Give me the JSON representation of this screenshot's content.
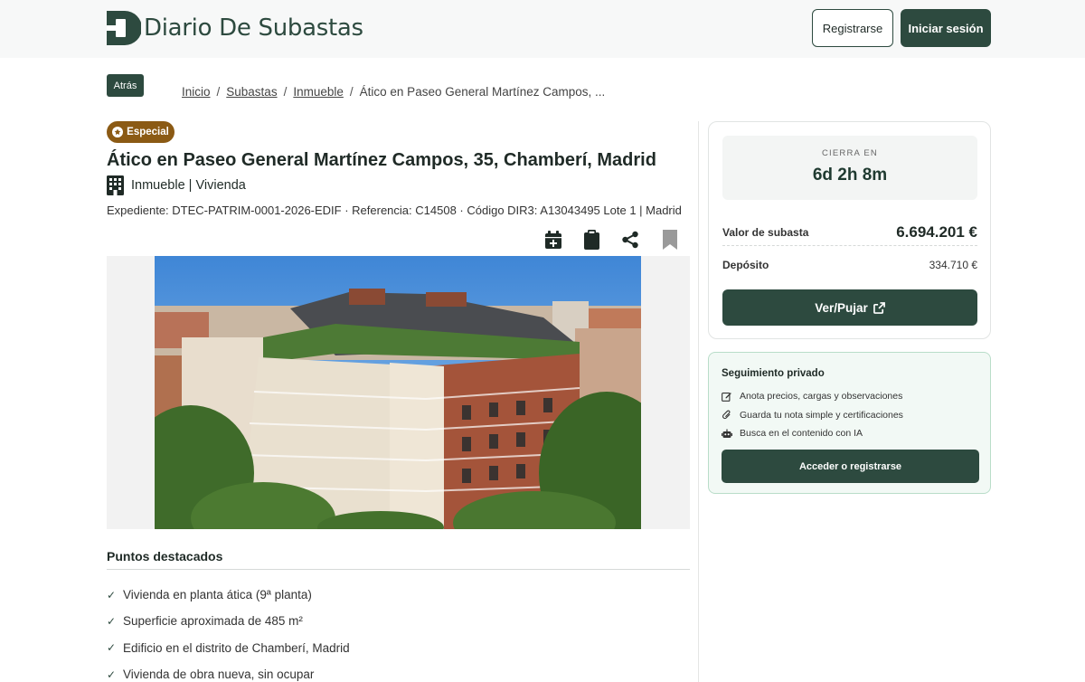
{
  "header": {
    "logo_text": "Diario De Subastas",
    "register_label": "Registrarse",
    "login_label": "Iniciar sesión"
  },
  "nav": {
    "back_label": "Atrás",
    "breadcrumb": [
      "Inicio",
      "Subastas",
      "Inmueble",
      "Ático en Paseo General Martínez Campos, ..."
    ]
  },
  "listing": {
    "badge": "Especial",
    "title": "Ático en Paseo General Martínez Campos, 35, Chamberí, Madrid",
    "category": "Inmueble | Vivienda",
    "meta": "Expediente: DTEC-PATRIM-0001-2026-EDIF · Referencia: C14508 · Código DIR3: A13043495 Lote 1 | Madrid",
    "actions": [
      "calendar-add-icon",
      "clipboard-icon",
      "share-icon",
      "bookmark-icon"
    ]
  },
  "highlights": {
    "title": "Puntos destacados",
    "items": [
      "Vivienda en planta ática (9ª planta)",
      "Superficie aproximada de 485 m²",
      "Edificio en el distrito de Chamberí, Madrid",
      "Vivienda de obra nueva, sin ocupar"
    ]
  },
  "auction": {
    "closes_label": "CIERRA EN",
    "countdown": "6d 2h 8m",
    "value_label": "Valor de subasta",
    "value": "6.694.201 €",
    "deposit_label": "Depósito",
    "deposit": "334.710 €",
    "bid_label": "Ver/Pujar"
  },
  "private": {
    "title": "Seguimiento privado",
    "items": [
      {
        "icon": "edit-icon",
        "text": "Anota precios, cargas y observaciones"
      },
      {
        "icon": "paperclip-icon",
        "text": "Guarda tu nota simple y certificaciones"
      },
      {
        "icon": "robot-icon",
        "text": "Busca en el contenido con IA"
      }
    ],
    "access_label": "Acceder o registrarse"
  },
  "colors": {
    "brand": "#2d4a3f",
    "badge": "#8b5a14",
    "private_bg": "#f2f9f5"
  }
}
